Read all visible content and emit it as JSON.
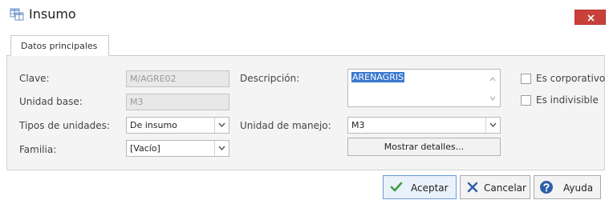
{
  "window": {
    "title": "Insumo"
  },
  "tabs": [
    {
      "label": "Datos principales"
    }
  ],
  "form": {
    "clave": {
      "label": "Clave:",
      "value": "M/AGRE02"
    },
    "unidad_base": {
      "label": "Unidad base:",
      "value": "M3"
    },
    "tipos_unidades": {
      "label": "Tipos de unidades:",
      "value": "De insumo"
    },
    "familia": {
      "label": "Familia:",
      "value": "[Vacío]"
    },
    "descripcion": {
      "label": "Descripción:",
      "value": "ARENAGRIS"
    },
    "unidad_manejo": {
      "label": "Unidad de manejo:",
      "value": "M3"
    },
    "es_corporativo": {
      "label": "Es corporativo",
      "checked": false
    },
    "es_indivisible": {
      "label": "Es indivisible",
      "checked": false
    },
    "mostrar_detalles": "Mostrar detalles..."
  },
  "buttons": {
    "aceptar": "Aceptar",
    "cancelar": "Cancelar",
    "ayuda": "Ayuda"
  },
  "colors": {
    "close": "#c9403a",
    "selection": "#3a78d0",
    "accept_icon": "#3f9b3f",
    "cancel_icon": "#2f5ea8",
    "help_icon": "#2f5ea8"
  },
  "icons": {
    "app": "table-icon",
    "close": "close-icon",
    "accept": "check-icon",
    "cancel": "x-icon",
    "help": "help-icon"
  }
}
